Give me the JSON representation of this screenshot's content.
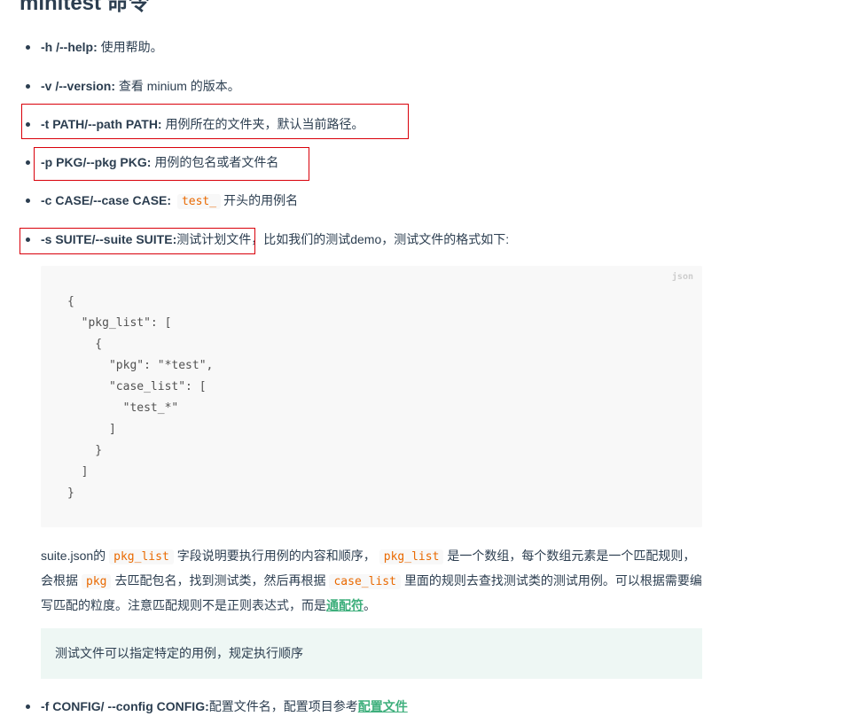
{
  "title": "minitest 命令",
  "options": {
    "h": {
      "flag": "-h /--help:",
      "desc": " 使用帮助。"
    },
    "v": {
      "flag": "-v /--version:",
      "desc": " 查看 minium 的版本。"
    },
    "t": {
      "flag": "-t PATH/--path PATH:",
      "desc": " 用例所在的文件夹，默认当前路径。"
    },
    "p": {
      "flag": "-p PKG/--pkg PKG:",
      "desc": " 用例的包名或者文件名"
    },
    "c": {
      "flag": "-c CASE/--case CASE:",
      "code": "test_",
      "desc": "开头的用例名"
    },
    "s": {
      "flag": "-s SUITE/--suite SUITE:",
      "desc": "测试计划文件，比如我们的测试demo，测试文件的格式如下:"
    },
    "f": {
      "flag": "-f CONFIG/ --config CONFIG:",
      "desc": "配置文件名，配置项目参考",
      "link": "配置文件"
    }
  },
  "code_block": {
    "lang": "json",
    "content": "{\n  \"pkg_list\": [\n    {\n      \"pkg\": \"*test\",\n      \"case_list\": [\n        \"test_*\"\n      ]\n    }\n  ]\n}"
  },
  "paragraph": {
    "part1": "suite.json的",
    "code1": "pkg_list",
    "part2": "字段说明要执行用例的内容和顺序，",
    "code2": "pkg_list",
    "part3": "是一个数组，每个数组元素是一个匹配规则，会根据",
    "code3": "pkg",
    "part4": "去匹配包名，找到测试类，然后再根据",
    "code4": "case_list",
    "part5": "里面的规则去查找测试类的测试用例。可以根据需要编写匹配的粒度。注意匹配规则不是正则表达式，而是",
    "link": "通配符",
    "part6": "。"
  },
  "tip": "测试文件可以指定特定的用例，规定执行顺序",
  "colors": {
    "text": "#2c3e50",
    "accent": "#3eaf7c",
    "inline_code": "#e96900",
    "highlight_box": "#d9000a",
    "tip_bg": "#eef7f4",
    "code_bg": "#f8f8f8"
  }
}
